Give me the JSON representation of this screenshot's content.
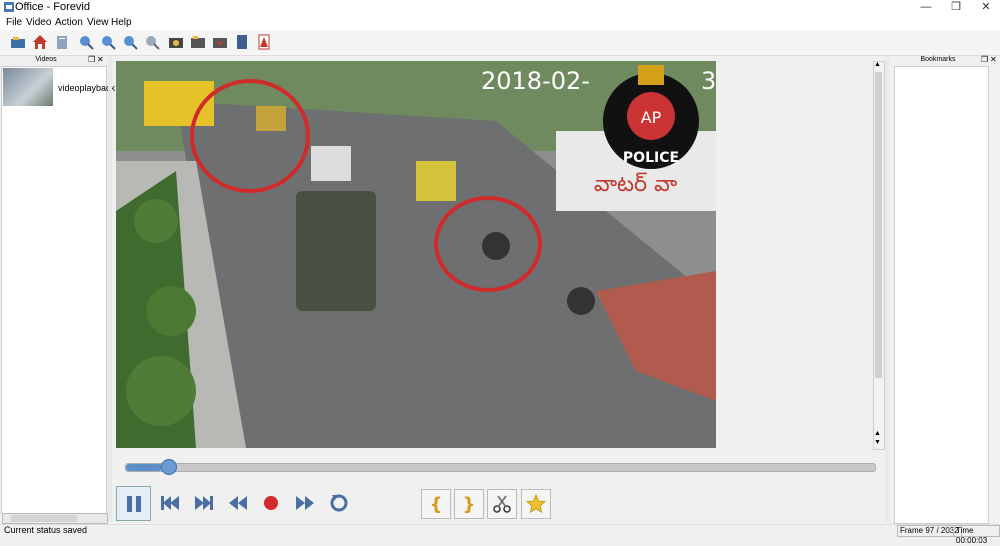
{
  "window": {
    "title": "Office - Forevid"
  },
  "menu": [
    "File",
    "Video",
    "Action",
    "View",
    "Help"
  ],
  "toolbar_icons": [
    "open-folder-icon",
    "home-icon",
    "clipboard-icon",
    "zoom-in-icon",
    "zoom-out-icon",
    "zoom-fit-icon",
    "zoom-reset-icon",
    "snapshot-icon",
    "export-icon",
    "record-icon",
    "file-icon",
    "pdf-icon"
  ],
  "videos_panel": {
    "title": "Videos",
    "items": [
      {
        "label": "videoplayback"
      }
    ]
  },
  "bookmarks_panel": {
    "title": "Bookmarks"
  },
  "video": {
    "timestamp": "2018-02-",
    "timestamp_tail": "3",
    "overlay_logo": {
      "abbr": "AP",
      "text": "POLICE"
    },
    "signboard_text": "వాటర్ వా"
  },
  "seek": {
    "progress": 0.048
  },
  "status": {
    "message": "Current status saved",
    "frame": "Frame 97 / 2032",
    "time": "Time 00:00:03"
  }
}
